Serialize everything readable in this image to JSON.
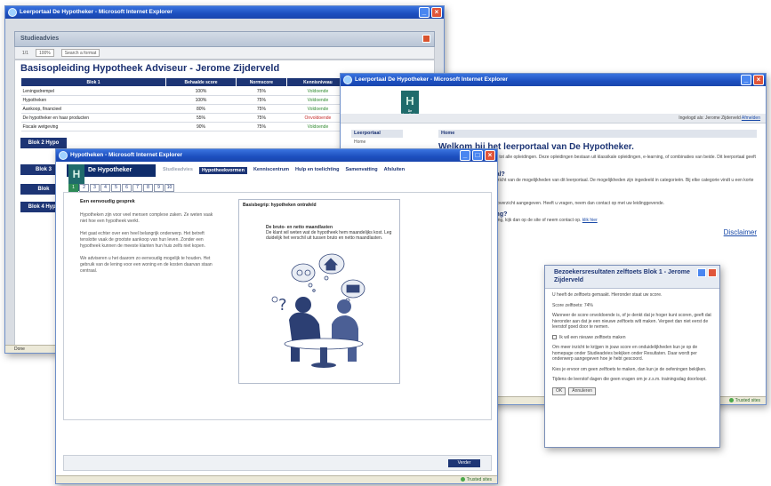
{
  "colors": {
    "xp_titlebar": "#1c4fbf",
    "navy": "#1d3575",
    "teal_logo": "#1f6b6b",
    "ok_green": "#2f8a2f",
    "fail_red": "#c62b2b"
  },
  "win1": {
    "title": "Leerportaal De Hypotheker - Microsoft Internet Explorer",
    "inner_title": "Studieadvies",
    "toolbar": {
      "page": "1/1",
      "zoom": "100%",
      "search_placeholder": "Search a format"
    },
    "doc_title": "Basisopleiding Hypotheek Adviseur - Jerome Zijderveld",
    "table": {
      "headers": [
        "Blok 1",
        "Behaalde score",
        "Normscore",
        "Kennisniveau"
      ],
      "rows": [
        [
          "Leningsdrempel",
          "100%",
          "75%",
          "Voldoende"
        ],
        [
          "Hypotheken",
          "100%",
          "75%",
          "Voldoende"
        ],
        [
          "Aankoop, financieel",
          "80%",
          "75%",
          "Voldoende"
        ],
        [
          "De hypotheker en haar producten",
          "55%",
          "75%",
          "Onvoldoende"
        ],
        [
          "Fiscale wetgeving",
          "90%",
          "75%",
          "Voldoende"
        ]
      ]
    },
    "blok_bars": [
      "Blok 2 Hypo",
      "Blok 3",
      "Blok",
      "Blok 4 Hypo"
    ],
    "status": "Done"
  },
  "win2": {
    "title": "Leerportaal De Hypotheker - Microsoft Internet Explorer",
    "logo_letter": "H",
    "logo_sub": "De Hypotheker",
    "user_line": "Ingelogd als: Jerome Zijderveld",
    "logout": "Afmelden",
    "side_head": "Leerportaal",
    "side_item": "Home",
    "main_head": "Home",
    "welcome": "Welkom bij het leerportaal van De Hypotheker.",
    "para1": "Dit leerportaal biedt u toegang tot alle opleidingen. Deze opleidingen bestaan uit klassikale opleidingen, e-learning, of combinaties van beide. Dit leerportaal geeft u daarvan een overzicht.",
    "sec1": "Wat is het leerportaal?",
    "para2": "Het leerportaal geeft een overzicht van de mogelijkheden van dit leerportaal. De mogelijkheden zijn ingedeeld in categorieën. Bij elke categorie vindt u een korte toelichting.",
    "sec2": "Opleiding",
    "para3": "Volg de opleiding zoals in het overzicht aangegeven. Heeft u vragen, neem dan contact op met uw leidinggevende.",
    "sec3": "Aanmelding opleiding?",
    "para4": "Heeft u vragen over de opleiding, kijk dan op de site of neem contact op.",
    "link": "klik hier",
    "right_link": "Disclaimer",
    "status": "Trusted sites"
  },
  "win3": {
    "title": "Hypotheken - Microsoft Internet Explorer",
    "brand": "De Hypotheker",
    "brand_letter": "H",
    "menu": [
      "Studieadvies",
      "Hypotheekvormen",
      "Kenniscentrum",
      "Hulp en toelichting",
      "Samenvatting",
      "Afsluiten"
    ],
    "pager": [
      "1",
      "2",
      "3",
      "4",
      "5",
      "6",
      "7",
      "8",
      "9",
      "10"
    ],
    "lesson_title": "Een eenvoudig gesprek",
    "lesson_p1": "Hypotheken zijn voor veel mensen complexe zaken. Ze weten vaak niet hoe een hypotheek werkt.",
    "lesson_p2": "Het gaat echter over een heel belangrijk onderwerp. Het betreft tenslotte vaak de grootste aankoop van hun leven. Zonder een hypotheek kunnen de meeste klanten hun huis zelfs niet kopen.",
    "lesson_p3": "We adviseren u het daarom zo eenvoudig mogelijk te houden. Het gebruik van de lening voor een woning en de kosten daarvan staan centraal.",
    "illus_head": "Basisbegrip: hypotheken ontrafeld",
    "illus_sub_title": "De bruto- en netto maandlasten",
    "illus_sub_text": "De klant wil weten wat de hypotheek hem maandelijks kost. Leg duidelijk het verschil uit tussen bruto en netto maandlasten.",
    "next": "Verder",
    "status": "Trusted sites"
  },
  "win4": {
    "title": "Bezoekersresultaten zelftoets Blok 1 - Jerome Zijderveld",
    "p1": "U heeft de zelftoets gemaakt. Hieronder staat uw score.",
    "p2": "Score zelftoets: 74%",
    "p3": "Wanneer de score onvoldoende is, of je denkt dat je hoger kunt scoren, geeft dat hieronder aan dat je een nieuwe zelftoets wilt maken. Vergeet dan niet eerst de leerstof goed door te nemen.",
    "checkbox": "Ik wil een nieuwe zelftoets maken",
    "p4": "Om meer inzicht te krijgen in jouw score en onduidelijkheden kun je op de homepage onder Studieadvies bekijken onder Resultaten. Daar wordt per onderwerp aangegeven hoe je hebt gescoord.",
    "p5": "Kies je ervoor om geen zelftoets te maken, dan kun je de oefeningen bekijken.",
    "p6": "Tijdens de leerstof dagen die geen vragen om je z.s.m. trainingsdag doorloopt.",
    "ok": "OK",
    "cancel": "Annuleren"
  }
}
